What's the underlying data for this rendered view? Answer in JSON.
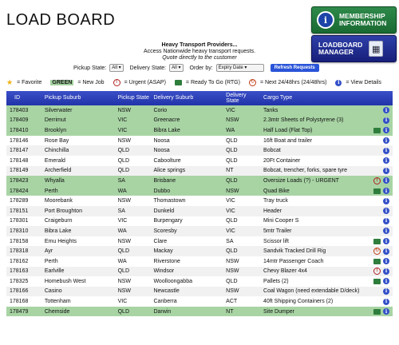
{
  "page": {
    "title": "LOAD BOARD",
    "intro_line1": "Heavy Transport Providers...",
    "intro_line2": "Access Nationwide heavy transport requests.",
    "intro_line3": "Quote directly to the customer"
  },
  "buttons": {
    "membership_line1": "MEMBERSHIP",
    "membership_line2": "INFORMATION",
    "manager_line1": "LOADBOARD",
    "manager_line2": "MANAGER"
  },
  "filters": {
    "pickup_label": "Pickup State:",
    "pickup_value": "All",
    "delivery_label": "Delivery State:",
    "delivery_value": "All",
    "order_label": "Order by:",
    "order_value": "Expiry Date",
    "refresh_label": "Refresh Requests"
  },
  "legend": {
    "favorite": "= Favorite",
    "green_word": "GREEN",
    "new_job": "= New Job",
    "urgent": "= Urgent (ASAP)",
    "rtg": "= Ready To Go (RTG)",
    "next24": "= Next 24/48hrs (24/48hrs)",
    "details": "= View Details"
  },
  "table": {
    "headers": [
      "ID",
      "Pickup Suburb",
      "Pickup State",
      "Delivery Suburb",
      "Delivery State",
      "Cargo Type"
    ],
    "rows": [
      {
        "id": "178403",
        "pickup": "Silverwater",
        "pstate": "NSW",
        "delivery": "Corio",
        "dstate": "VIC",
        "cargo": "Tanks",
        "new": true,
        "flags": []
      },
      {
        "id": "178409",
        "pickup": "Derrimut",
        "pstate": "VIC",
        "delivery": "Greenacre",
        "dstate": "NSW",
        "cargo": "2.3mtr Sheets of Polystyrene (3)",
        "new": true,
        "flags": []
      },
      {
        "id": "178410",
        "pickup": "Brooklyn",
        "pstate": "VIC",
        "delivery": "Bibra Lake",
        "dstate": "WA",
        "cargo": "Half Load (Flat Top)",
        "new": true,
        "flags": [
          "rtg"
        ]
      },
      {
        "id": "178146",
        "pickup": "Rose Bay",
        "pstate": "NSW",
        "delivery": "Noosa",
        "dstate": "QLD",
        "cargo": "16ft Boat and trailer",
        "new": false,
        "flags": []
      },
      {
        "id": "178147",
        "pickup": "Chinchilla",
        "pstate": "QLD",
        "delivery": "Noosa",
        "dstate": "QLD",
        "cargo": "Bobcat",
        "new": false,
        "flags": []
      },
      {
        "id": "178148",
        "pickup": "Emerald",
        "pstate": "QLD",
        "delivery": "Caboolture",
        "dstate": "QLD",
        "cargo": "20Ft Container",
        "new": false,
        "flags": []
      },
      {
        "id": "178149",
        "pickup": "Archerfield",
        "pstate": "QLD",
        "delivery": "Alice springs",
        "dstate": "NT",
        "cargo": "Bobcat, trencher, forks, spare tyre",
        "new": false,
        "flags": []
      },
      {
        "id": "178423",
        "pickup": "Whyalla",
        "pstate": "SA",
        "delivery": "Brisbane",
        "dstate": "QLD",
        "cargo": "Oversize Loads (?) - URGENT",
        "new": true,
        "flags": [
          "urgent"
        ]
      },
      {
        "id": "178424",
        "pickup": "Perth",
        "pstate": "WA",
        "delivery": "Dubbo",
        "dstate": "NSW",
        "cargo": "Quad Bike",
        "new": true,
        "flags": [
          "rtg"
        ]
      },
      {
        "id": "178289",
        "pickup": "Moorebank",
        "pstate": "NSW",
        "delivery": "Thomastown",
        "dstate": "VIC",
        "cargo": "Tray truck",
        "new": false,
        "flags": []
      },
      {
        "id": "178151",
        "pickup": "Port Broughton",
        "pstate": "SA",
        "delivery": "Dunkeld",
        "dstate": "VIC",
        "cargo": "Header",
        "new": false,
        "flags": []
      },
      {
        "id": "178301",
        "pickup": "Craigeburn",
        "pstate": "VIC",
        "delivery": "Burpengary",
        "dstate": "QLD",
        "cargo": "Mini Cooper S",
        "new": false,
        "flags": []
      },
      {
        "id": "178310",
        "pickup": "Bibra Lake",
        "pstate": "WA",
        "delivery": "Scoresby",
        "dstate": "VIC",
        "cargo": "5mtr Trailer",
        "new": false,
        "flags": []
      },
      {
        "id": "178158",
        "pickup": "Emu Heights",
        "pstate": "NSW",
        "delivery": "Clare",
        "dstate": "SA",
        "cargo": "Scissor lift",
        "new": false,
        "flags": [
          "rtg"
        ]
      },
      {
        "id": "178318",
        "pickup": "Ayr",
        "pstate": "QLD",
        "delivery": "Mackay",
        "dstate": "QLD",
        "cargo": "Sandvik Tracked Drill Rig",
        "new": false,
        "flags": [
          "next24"
        ]
      },
      {
        "id": "178162",
        "pickup": "Perth",
        "pstate": "WA",
        "delivery": "Riverstone",
        "dstate": "NSW",
        "cargo": "14mtr Passenger Coach",
        "new": false,
        "flags": [
          "rtg"
        ]
      },
      {
        "id": "178163",
        "pickup": "Earlville",
        "pstate": "QLD",
        "delivery": "Windsor",
        "dstate": "NSW",
        "cargo": "Chevy Blazer 4x4",
        "new": false,
        "flags": [
          "urgent"
        ]
      },
      {
        "id": "178325",
        "pickup": "Homebush West",
        "pstate": "NSW",
        "delivery": "Woolloongabba",
        "dstate": "QLD",
        "cargo": "Pallets (2)",
        "new": false,
        "flags": [
          "rtg"
        ]
      },
      {
        "id": "178166",
        "pickup": "Casino",
        "pstate": "NSW",
        "delivery": "Newcastle",
        "dstate": "NSW",
        "cargo": "Coal Wagon (need extendable D/deck)",
        "new": false,
        "flags": []
      },
      {
        "id": "178168",
        "pickup": "Tottenham",
        "pstate": "VIC",
        "delivery": "Canberra",
        "dstate": "ACT",
        "cargo": "40ft Shipping Containers (2)",
        "new": false,
        "flags": []
      },
      {
        "id": "178479",
        "pickup": "Chemside",
        "pstate": "QLD",
        "delivery": "Darwin",
        "dstate": "NT",
        "cargo": "Site Dumper",
        "new": true,
        "flags": [
          "rtg"
        ]
      }
    ]
  },
  "colors": {
    "header_blue": "#2a3cb8",
    "new_job_green": "#a8d4a4",
    "membership_green": "#22783e",
    "manager_blue": "#1f2c94"
  }
}
